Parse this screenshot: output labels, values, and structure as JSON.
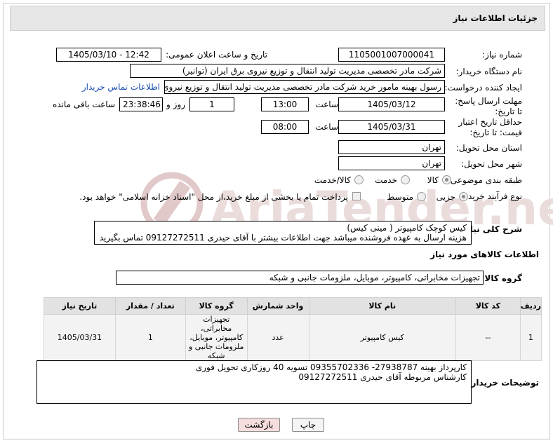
{
  "header": {
    "title": "جزئیات اطلاعات نیاز"
  },
  "fields": {
    "need_number_label": "شماره نیاز:",
    "need_number": "1105001007000041",
    "announce_label": "تاریخ و ساعت اعلان عمومی:",
    "announce_value": "1405/03/10 - 12:42",
    "buyer_org_label": "نام دستگاه خریدار:",
    "buyer_org": "شرکت مادر تخصصی مدیریت تولید  انتقال و توزیع نیروی برق ایران (توانیر)",
    "creator_label": "ایجاد کننده درخواست:",
    "creator": "رسول بهینه مامور خرید شرکت مادر تخصصی مدیریت تولید  انتقال و توزیع نیروی",
    "contact_link": "اطلاعات تماس خریدار",
    "reply_deadline_label": "مهلت ارسال پاسخ: تا تاریخ:",
    "reply_date": "1405/03/12",
    "time_label": "ساعت",
    "reply_time": "13:00",
    "days_value": "1",
    "days_label": "روز و",
    "remaining_value": "23:38:46",
    "remaining_label": "ساعت باقی مانده",
    "price_deadline_label": "حداقل تاریخ اعتبار قیمت: تا تاریخ:",
    "price_date": "1405/03/31",
    "price_time": "08:00",
    "province_label": "استان محل تحویل:",
    "province": "تهران",
    "city_label": "شهر محل تحویل:",
    "city": "تهران",
    "category_label": "طبقه بندی موضوعی:",
    "cat_goods": "کالا",
    "cat_service": "خدمت",
    "cat_both": "کالا/خدمت",
    "process_label": "نوع فرآیند خرید :",
    "proc_partial": "جزیی",
    "proc_medium": "متوسط",
    "payment_note": "پرداخت تمام یا بخشی از مبلغ خرید،از محل \"اسناد خزانه اسلامی\" خواهد بود.",
    "summary_label": "شرح کلی نیاز:",
    "summary_line1": "کیس کوچک کامپیوتر ( مینی کیس)",
    "summary_line2": "هزینه ارسال به عهده فروشنده میباشد جهت اطلاعات بیشتر با آقای حیدری  09127272511  تماس بگیرید",
    "goods_info_title": "اطلاعات کالاهای مورد نیاز",
    "goods_group_label": "گروه کالا:",
    "goods_group": "تجهیزات مخابراتی، کامپیوتر، موبایل، ملزومات جانبی و شبکه"
  },
  "table": {
    "headers": [
      "ردیف",
      "کد کالا",
      "نام کالا",
      "واحد شمارش",
      "گروه کالا",
      "تعداد / مقدار",
      "تاریخ نیاز"
    ],
    "rows": [
      [
        "1",
        "--",
        "کیس کامپیوتر",
        "عدد",
        "تجهیزات مخابراتی، کامپیوتر، موبایل، ملزومات جانبی و شبکه",
        "1",
        "1405/03/31"
      ]
    ]
  },
  "buyer_notes": {
    "label": "توضیحات خریدار:",
    "line1": "کارپرداز بهینه 27938787- 09355702336  تسویه 40 روزکاری تحویل فوری",
    "line2": "کارشناس مربوطه آقای حیدری  09127272511"
  },
  "buttons": {
    "print": "چاپ",
    "back": "بازگشت"
  },
  "watermark": "AriaTender.neT",
  "colors": {
    "header_bg": "#e6e6e6",
    "table_header_bg": "#e2e2e2",
    "link": "#1a4fb5",
    "back_button_bg": "#f7dede",
    "watermark": "#e2c9c9"
  }
}
